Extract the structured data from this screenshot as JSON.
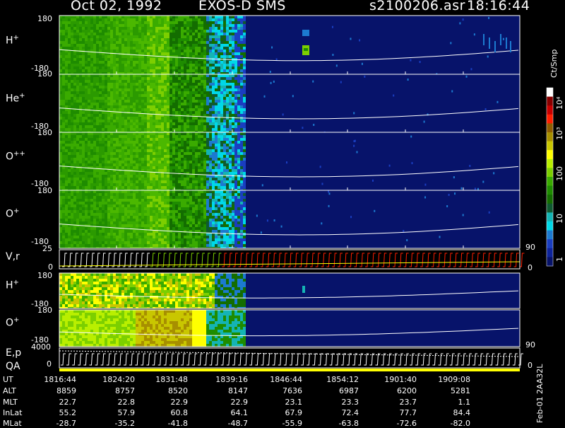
{
  "header": {
    "date": "Oct 02, 1992",
    "instrument": "EXOS-D SMS",
    "file": "s2100206.asr",
    "time": "18:16:44"
  },
  "panels": {
    "h_plus": {
      "name": "H",
      "sup": "+",
      "ymax": "180",
      "ymin": "-180"
    },
    "he_plus": {
      "name": "He",
      "sup": "+",
      "ymax": "180",
      "ymin": "-180"
    },
    "o_pp": {
      "name": "O",
      "sup": "++",
      "ymax": "180",
      "ymin": "-180"
    },
    "o_plus": {
      "name": "O",
      "sup": "+",
      "ymax": "180",
      "ymin": "-180"
    },
    "vr": {
      "name": "V,r",
      "ymax": "25",
      "ymin": "0",
      "rmax": "90",
      "rmin": "0"
    },
    "h_plus_2": {
      "name": "H",
      "sup": "+",
      "ymax": "180",
      "ymin": "-180"
    },
    "o_plus_2": {
      "name": "O",
      "sup": "+",
      "ymax": "180",
      "ymin": "-180"
    },
    "ep": {
      "name1": "E,p",
      "name2": "QA",
      "ymax": "4000",
      "ymin": "0",
      "rmax": "90",
      "rmin": "0"
    }
  },
  "colorbar": {
    "units": "Ct/Smp",
    "labels": [
      "10⁴",
      "10³",
      "100",
      "10",
      "1"
    ],
    "colors": [
      "#ffffff",
      "#8a0000",
      "#c80000",
      "#ff1e00",
      "#8f5d00",
      "#a78f00",
      "#c9c600",
      "#ffff00",
      "#b9ef00",
      "#7ccf00",
      "#3aab00",
      "#1e8c00",
      "#136d00",
      "#0f5a30",
      "#14b4b4",
      "#00d8e8",
      "#1c7ad0",
      "#1a3ec0",
      "#0e249a",
      "#07136a"
    ]
  },
  "footer": {
    "stamp": "Feb-01 2AA32L",
    "rows": [
      "UT",
      "ALT",
      "MLT",
      "InLat",
      "MLat"
    ],
    "columns": [
      {
        "UT": "1816:44",
        "ALT": "8859",
        "MLT": "22.7",
        "InLat": "55.2",
        "MLat": "-28.7"
      },
      {
        "UT": "1824:20",
        "ALT": "8757",
        "MLT": "22.8",
        "InLat": "57.9",
        "MLat": "-35.2"
      },
      {
        "UT": "1831:48",
        "ALT": "8520",
        "MLT": "22.9",
        "InLat": "60.8",
        "MLat": "-41.8"
      },
      {
        "UT": "1839:16",
        "ALT": "8147",
        "MLT": "22.9",
        "InLat": "64.1",
        "MLat": "-48.7"
      },
      {
        "UT": "1846:44",
        "ALT": "7636",
        "MLT": "23.1",
        "InLat": "67.9",
        "MLat": "-55.9"
      },
      {
        "UT": "1854:12",
        "ALT": "6987",
        "MLT": "23.3",
        "InLat": "72.4",
        "MLat": "-63.8"
      },
      {
        "UT": "1901:40",
        "ALT": "6200",
        "MLT": "23.7",
        "InLat": "77.7",
        "MLat": "-72.6"
      },
      {
        "UT": "1909:08",
        "ALT": "5281",
        "MLT": "1.1",
        "InLat": "84.4",
        "MLat": "-82.0"
      }
    ]
  },
  "chart_data": {
    "type": "heatmap",
    "title": "Oct 02, 1992   EXOS-D SMS",
    "x_tick_labels": [
      "1816:44",
      "1824:20",
      "1831:48",
      "1839:16",
      "1846:44",
      "1854:12",
      "1901:40",
      "1909:08"
    ],
    "series": [
      {
        "name": "H+",
        "ylim": [
          -180,
          180
        ]
      },
      {
        "name": "He+",
        "ylim": [
          -180,
          180
        ]
      },
      {
        "name": "O++",
        "ylim": [
          -180,
          180
        ]
      },
      {
        "name": "O+",
        "ylim": [
          -180,
          180
        ]
      },
      {
        "name": "V,r",
        "ylim": [
          0,
          25
        ],
        "right_ylim": [
          0,
          90
        ]
      },
      {
        "name": "H+",
        "ylim": [
          -180,
          180
        ]
      },
      {
        "name": "O+",
        "ylim": [
          -180,
          180
        ]
      },
      {
        "name": "E,p",
        "ylim": [
          0,
          4000
        ],
        "right_ylim": [
          0,
          90
        ]
      }
    ],
    "colorbar": {
      "label": "Ct/Smp",
      "scale": "log",
      "range": [
        1,
        10000
      ]
    }
  }
}
